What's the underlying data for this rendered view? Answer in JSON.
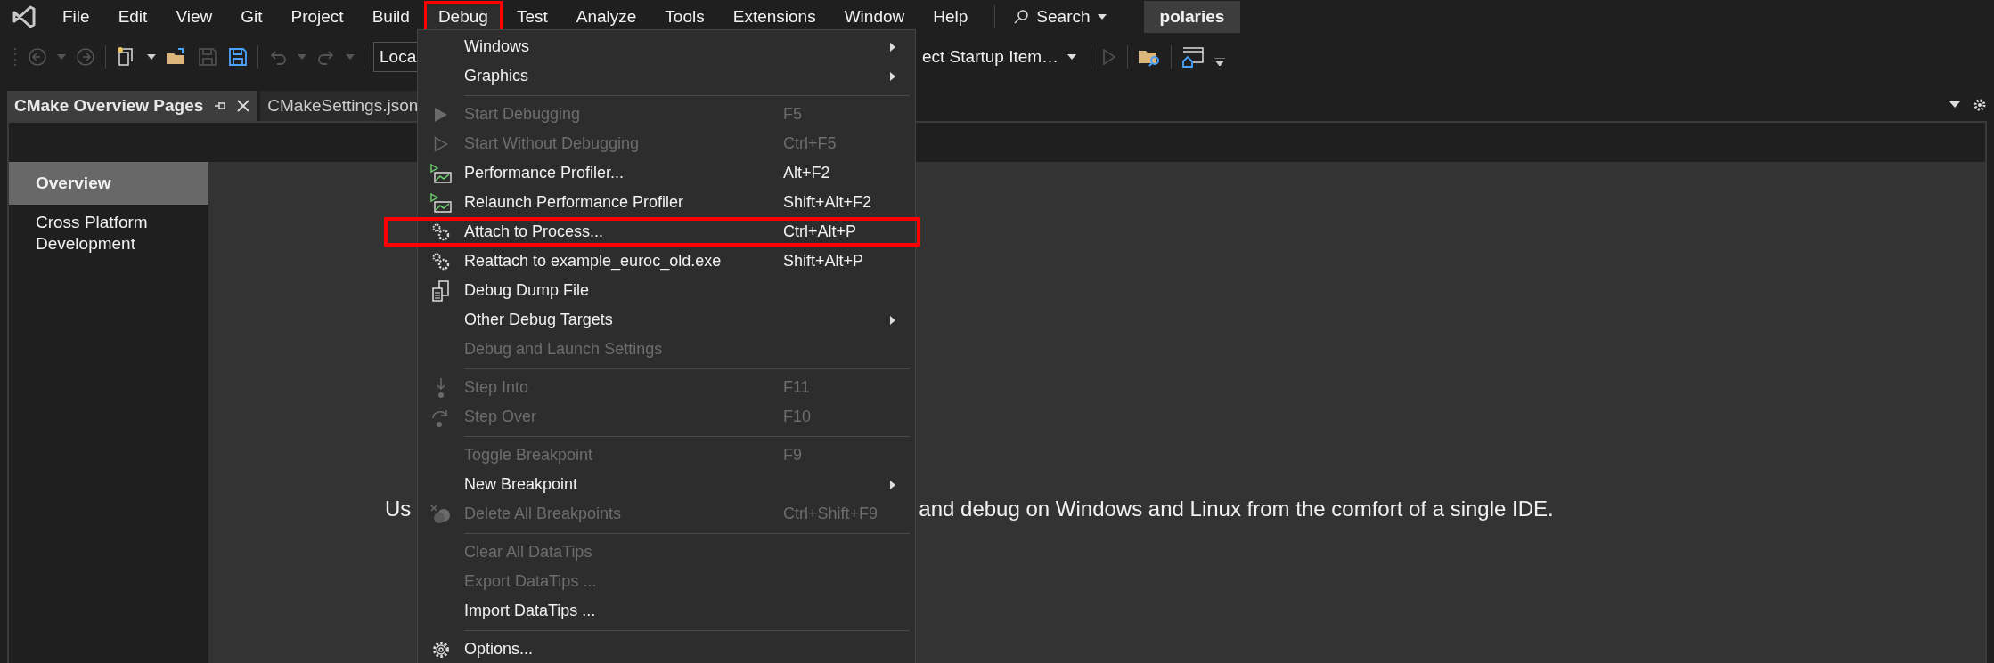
{
  "menu_bar": [
    {
      "label": "File",
      "open": false,
      "highlighted": false
    },
    {
      "label": "Edit",
      "open": false,
      "highlighted": false
    },
    {
      "label": "View",
      "open": false,
      "highlighted": false
    },
    {
      "label": "Git",
      "open": false,
      "highlighted": false
    },
    {
      "label": "Project",
      "open": false,
      "highlighted": false
    },
    {
      "label": "Build",
      "open": false,
      "highlighted": false
    },
    {
      "label": "Debug",
      "open": true,
      "highlighted": true
    },
    {
      "label": "Test",
      "open": false,
      "highlighted": false
    },
    {
      "label": "Analyze",
      "open": false,
      "highlighted": false
    },
    {
      "label": "Tools",
      "open": false,
      "highlighted": false
    },
    {
      "label": "Extensions",
      "open": false,
      "highlighted": false
    },
    {
      "label": "Window",
      "open": false,
      "highlighted": false
    },
    {
      "label": "Help",
      "open": false,
      "highlighted": false
    }
  ],
  "search": {
    "label": "Search"
  },
  "solution_name": "polaries",
  "toolbar": {
    "configuration": "Loca",
    "startup_item": "ect Startup Item…"
  },
  "tabs": [
    {
      "label": "CMake Overview Pages",
      "selected": true
    },
    {
      "label": "CMakeSettings.json",
      "selected": false
    }
  ],
  "nav": [
    {
      "label": "Overview",
      "selected": true
    },
    {
      "label": "Cross Platform Development",
      "selected": false
    }
  ],
  "page": {
    "intro_start": "Us",
    "intro_end": "and debug on Windows and Linux from the comfort of a single IDE."
  },
  "debug_menu": [
    {
      "kind": "item",
      "label": "Windows",
      "submenu": true,
      "disabled": false,
      "highlighted": false
    },
    {
      "kind": "item",
      "label": "Graphics",
      "submenu": true,
      "disabled": false,
      "highlighted": false
    },
    {
      "kind": "separator"
    },
    {
      "kind": "item",
      "label": "Start Debugging",
      "shortcut": "F5",
      "submenu": false,
      "disabled": true,
      "highlighted": false
    },
    {
      "kind": "item",
      "label": "Start Without Debugging",
      "shortcut": "Ctrl+F5",
      "submenu": false,
      "disabled": true,
      "highlighted": false
    },
    {
      "kind": "item",
      "label": "Performance Profiler...",
      "shortcut": "Alt+F2",
      "submenu": false,
      "disabled": false,
      "highlighted": false
    },
    {
      "kind": "item",
      "label": "Relaunch Performance Profiler",
      "shortcut": "Shift+Alt+F2",
      "submenu": false,
      "disabled": false,
      "highlighted": false
    },
    {
      "kind": "item",
      "label": "Attach to Process...",
      "shortcut": "Ctrl+Alt+P",
      "submenu": false,
      "disabled": false,
      "highlighted": true
    },
    {
      "kind": "item",
      "label": "Reattach to example_euroc_old.exe",
      "shortcut": "Shift+Alt+P",
      "submenu": false,
      "disabled": false,
      "highlighted": false
    },
    {
      "kind": "item",
      "label": "Debug Dump File",
      "submenu": false,
      "disabled": false,
      "highlighted": false
    },
    {
      "kind": "item",
      "label": "Other Debug Targets",
      "submenu": true,
      "disabled": false,
      "highlighted": false
    },
    {
      "kind": "item",
      "label": "Debug and Launch Settings",
      "submenu": false,
      "disabled": true,
      "highlighted": false
    },
    {
      "kind": "separator"
    },
    {
      "kind": "item",
      "label": "Step Into",
      "shortcut": "F11",
      "submenu": false,
      "disabled": true,
      "highlighted": false
    },
    {
      "kind": "item",
      "label": "Step Over",
      "shortcut": "F10",
      "submenu": false,
      "disabled": true,
      "highlighted": false
    },
    {
      "kind": "separator"
    },
    {
      "kind": "item",
      "label": "Toggle Breakpoint",
      "shortcut": "F9",
      "submenu": false,
      "disabled": true,
      "highlighted": false
    },
    {
      "kind": "item",
      "label": "New Breakpoint",
      "submenu": true,
      "disabled": false,
      "highlighted": false
    },
    {
      "kind": "item",
      "label": "Delete All Breakpoints",
      "shortcut": "Ctrl+Shift+F9",
      "submenu": false,
      "disabled": true,
      "highlighted": false
    },
    {
      "kind": "separator"
    },
    {
      "kind": "item",
      "label": "Clear All DataTips",
      "submenu": false,
      "disabled": true,
      "highlighted": false
    },
    {
      "kind": "item",
      "label": "Export DataTips ...",
      "submenu": false,
      "disabled": true,
      "highlighted": false
    },
    {
      "kind": "item",
      "label": "Import DataTips ...",
      "submenu": false,
      "disabled": false,
      "highlighted": false
    },
    {
      "kind": "separator"
    },
    {
      "kind": "item",
      "label": "Options...",
      "submenu": false,
      "disabled": false,
      "highlighted": false
    }
  ]
}
